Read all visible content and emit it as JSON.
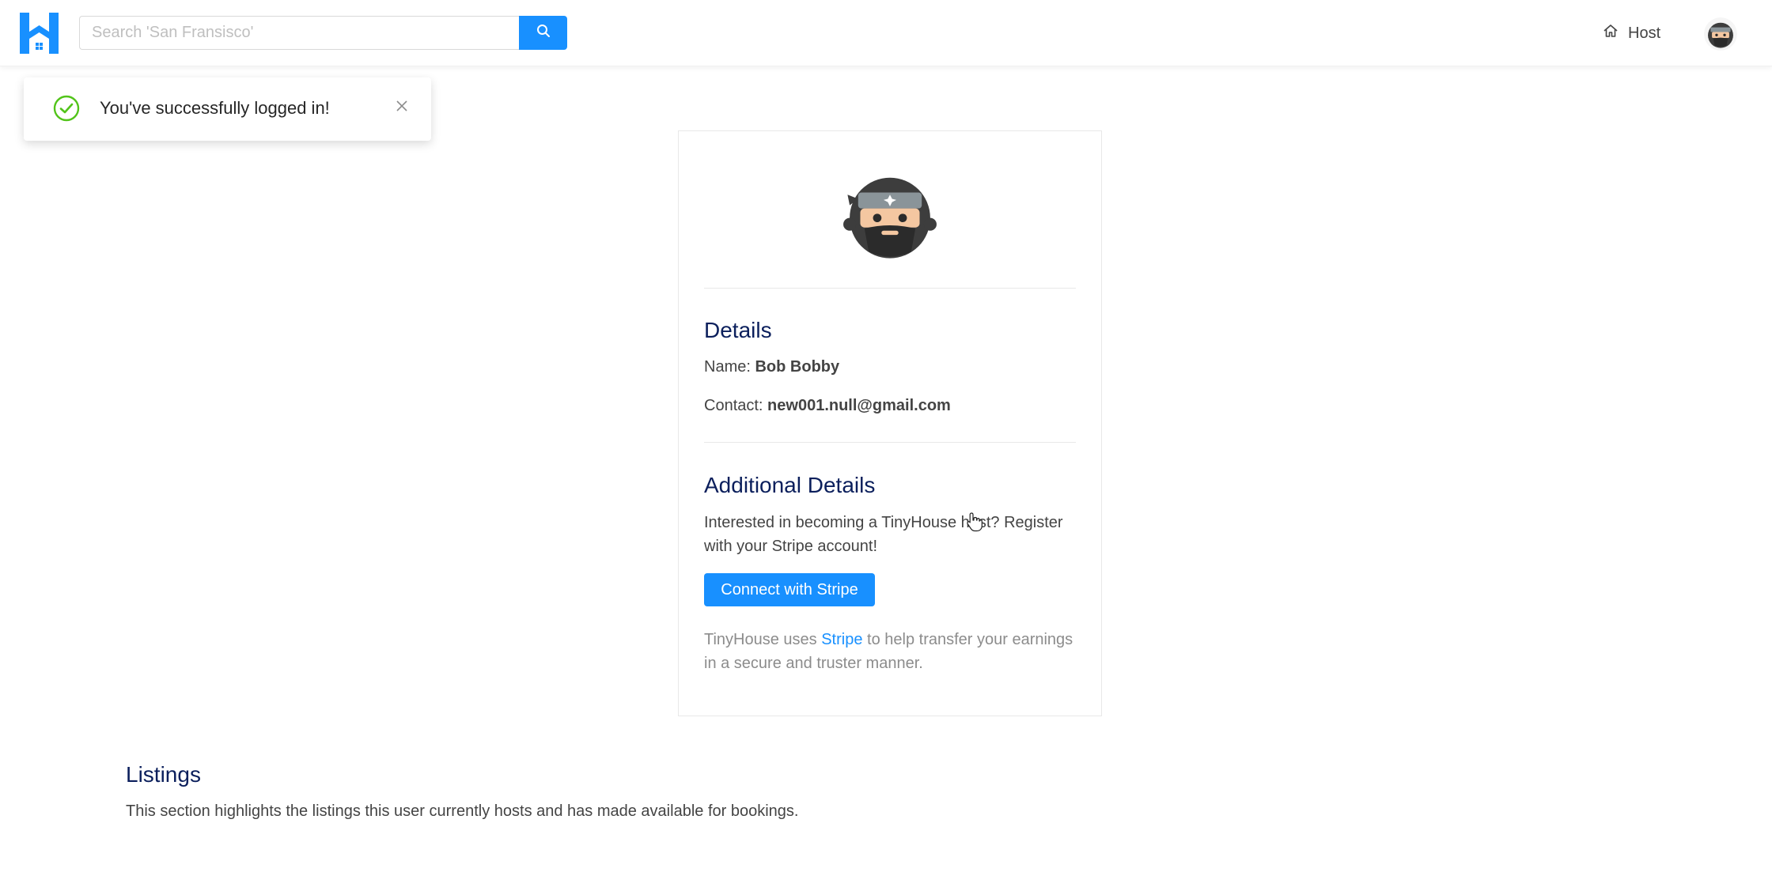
{
  "header": {
    "logo_icon": "house-logo-icon",
    "search": {
      "placeholder": "Search 'San Fransisco'",
      "value": "",
      "button_icon": "search-icon"
    },
    "host_label": "Host",
    "host_icon": "home-icon",
    "avatar_icon": "ninja-avatar-icon"
  },
  "notification": {
    "message": "You've successfully logged in!",
    "status_icon": "check-circle-icon",
    "close_icon": "close-icon",
    "color": "#52c41a"
  },
  "profile": {
    "avatar_icon": "ninja-avatar-icon",
    "details": {
      "title": "Details",
      "name_label": "Name:",
      "name_value": "Bob Bobby",
      "contact_label": "Contact:",
      "contact_value": "new001.null@gmail.com"
    },
    "additional": {
      "title": "Additional Details",
      "prompt": "Interested in becoming a TinyHouse host? Register with your Stripe account!",
      "button_label": "Connect with Stripe",
      "note_before": "TinyHouse uses",
      "note_link": "Stripe",
      "note_after": "to help transfer your earnings in a secure and truster manner."
    }
  },
  "listings": {
    "title": "Listings",
    "description": "This section highlights the listings this user currently hosts and has made available for bookings."
  },
  "colors": {
    "primary": "#1890ff",
    "title": "#0b1f5c",
    "text": "#444444",
    "muted": "#8c8c8c"
  }
}
